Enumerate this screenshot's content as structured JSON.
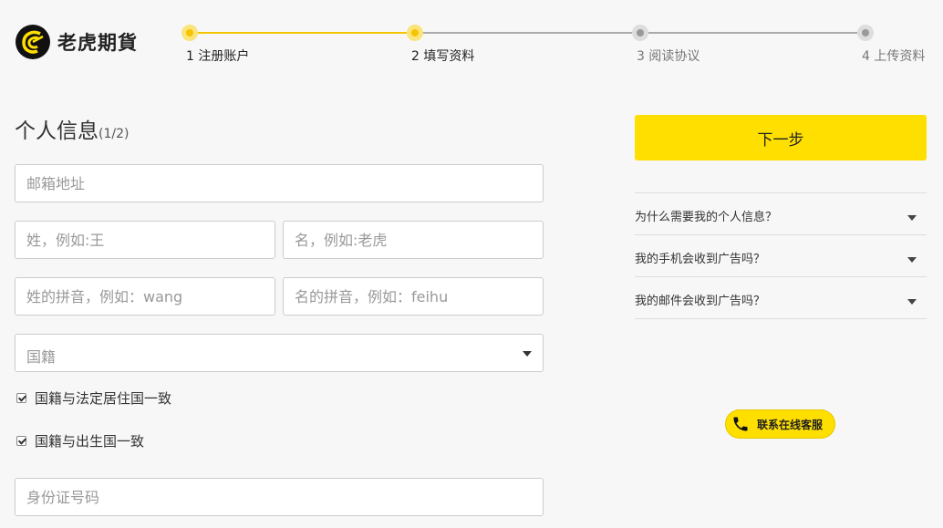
{
  "brand": {
    "name": "老虎期貨"
  },
  "steps": [
    {
      "label": "1 注册账户",
      "state": "active"
    },
    {
      "label": "2 填写资料",
      "state": "active"
    },
    {
      "label": "3 阅读协议",
      "state": "inactive"
    },
    {
      "label": "4 上传资料",
      "state": "inactive"
    }
  ],
  "form": {
    "title": "个人信息",
    "progress": "(1/2)",
    "email_placeholder": "邮箱地址",
    "surname_placeholder": "姓，例如:王",
    "given_name_placeholder": "名，例如:老虎",
    "surname_pinyin_placeholder": "姓的拼音，例如：wang",
    "given_pinyin_placeholder": "名的拼音，例如：feihu",
    "nationality_placeholder": "国籍",
    "check_residence_label": "国籍与法定居住国一致",
    "check_birth_label": "国籍与出生国一致",
    "id_number_placeholder": "身份证号码"
  },
  "sidebar": {
    "next_label": "下一步",
    "faq": [
      {
        "question": "为什么需要我的个人信息？"
      },
      {
        "question": "我的手机会收到广告吗？"
      },
      {
        "question": "我的邮件会收到广告吗？"
      }
    ],
    "contact_label": "联系在线客服"
  },
  "colors": {
    "accent": "#ffdf00",
    "step_active": "#f5c400",
    "step_inactive": "#999999"
  },
  "icons": {
    "logo": "tiger-logo-icon",
    "phone": "phone-icon",
    "dropdown": "chevron-down-icon"
  }
}
